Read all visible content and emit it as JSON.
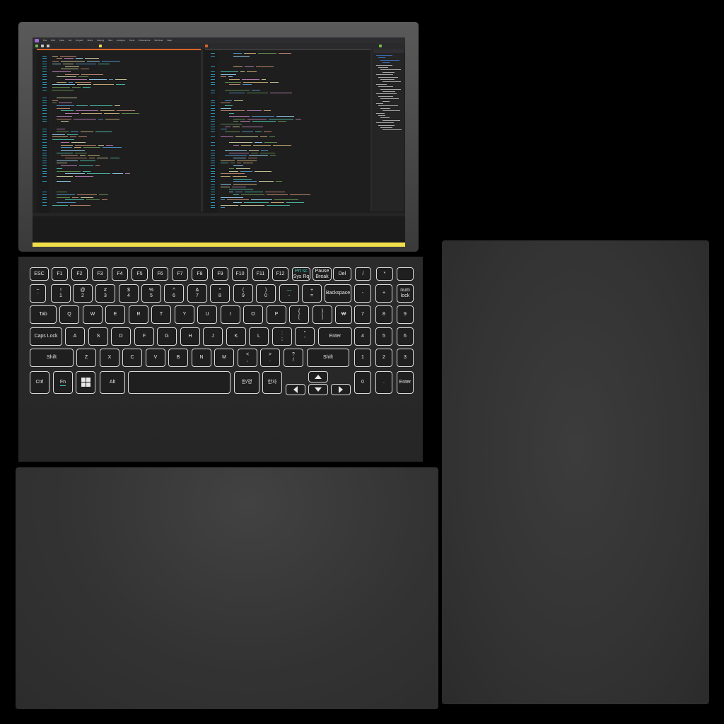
{
  "screen": {
    "menu_items": [
      "File",
      "Edit",
      "View",
      "Git",
      "Project",
      "Build",
      "Debug",
      "Test",
      "Analyze",
      "Tools",
      "Extensions",
      "Window",
      "Help"
    ],
    "colors": {
      "editor_bg": "#1e1e1e",
      "tab_accent": "#d9662b",
      "status_bar": "#f2e04a",
      "code_palette": [
        "#4ec9b0",
        "#dcdcaa",
        "#569cd6",
        "#ce9178",
        "#9cdcfe",
        "#c586c0",
        "#6a9955",
        "#d7ba7d"
      ]
    }
  },
  "keyboard": {
    "rows": [
      [
        {
          "name": "key-esc",
          "top": "ESC"
        },
        {
          "name": "key-f1",
          "top": "F1"
        },
        {
          "name": "key-f2",
          "top": "F2"
        },
        {
          "name": "key-f3",
          "top": "F3"
        },
        {
          "name": "key-f4",
          "top": "F4"
        },
        {
          "name": "key-f5",
          "top": "F5"
        },
        {
          "name": "key-f6",
          "top": "F6"
        },
        {
          "name": "key-f7",
          "top": "F7"
        },
        {
          "name": "key-f8",
          "top": "F8"
        },
        {
          "name": "key-f9",
          "top": "F9"
        },
        {
          "name": "key-f10",
          "top": "F10"
        },
        {
          "name": "key-f11",
          "top": "F11"
        },
        {
          "name": "key-f12",
          "top": "F12"
        },
        {
          "name": "key-prtsc",
          "top": "Prt sc",
          "bottom": "Sys Rq",
          "accent": true
        },
        {
          "name": "key-pause",
          "top": "Pause",
          "bottom": "Break"
        },
        {
          "name": "key-del",
          "top": "Del"
        },
        {
          "name": "key-numpad-divide",
          "top": "/"
        },
        {
          "name": "key-numpad-multiply",
          "top": "*"
        },
        {
          "name": "key-blank",
          "top": ""
        }
      ],
      [
        {
          "name": "key-tilde",
          "top": "~",
          "bottom": "`"
        },
        {
          "name": "key-1",
          "top": "!",
          "bottom": "1"
        },
        {
          "name": "key-2",
          "top": "@",
          "bottom": "2"
        },
        {
          "name": "key-3",
          "top": "#",
          "bottom": "3"
        },
        {
          "name": "key-4",
          "top": "$",
          "bottom": "4"
        },
        {
          "name": "key-5",
          "top": "%",
          "bottom": "5"
        },
        {
          "name": "key-6",
          "top": "^",
          "bottom": "6"
        },
        {
          "name": "key-7",
          "top": "&",
          "bottom": "7"
        },
        {
          "name": "key-8",
          "top": "*",
          "bottom": "8"
        },
        {
          "name": "key-9",
          "top": "(",
          "bottom": "9"
        },
        {
          "name": "key-0",
          "top": ")",
          "bottom": "0"
        },
        {
          "name": "key-minus",
          "top": "—",
          "bottom": "-",
          "accent": true
        },
        {
          "name": "key-equals",
          "top": "+",
          "bottom": "="
        },
        {
          "name": "key-backspace",
          "top": "Backspace"
        },
        {
          "name": "key-numpad-minus",
          "top": "-"
        },
        {
          "name": "key-numpad-plus",
          "top": "+"
        },
        {
          "name": "key-numlock",
          "top": "num",
          "bottom": "lock"
        }
      ],
      [
        {
          "name": "key-tab",
          "top": "Tab"
        },
        {
          "name": "key-q",
          "top": "Q"
        },
        {
          "name": "key-w",
          "top": "W"
        },
        {
          "name": "key-e",
          "top": "E"
        },
        {
          "name": "key-r",
          "top": "R"
        },
        {
          "name": "key-t",
          "top": "T"
        },
        {
          "name": "key-y",
          "top": "Y"
        },
        {
          "name": "key-u",
          "top": "U"
        },
        {
          "name": "key-i",
          "top": "I"
        },
        {
          "name": "key-o",
          "top": "O"
        },
        {
          "name": "key-p",
          "top": "P"
        },
        {
          "name": "key-left-bracket",
          "top": "{",
          "bottom": "["
        },
        {
          "name": "key-right-bracket",
          "top": "}",
          "bottom": "]"
        },
        {
          "name": "key-backslash",
          "top": "₩"
        },
        {
          "name": "key-numpad-7",
          "top": "7"
        },
        {
          "name": "key-numpad-8",
          "top": "8"
        },
        {
          "name": "key-numpad-9",
          "top": "9"
        }
      ],
      [
        {
          "name": "key-capslock",
          "top": "Caps Lock"
        },
        {
          "name": "key-a",
          "top": "A"
        },
        {
          "name": "key-s",
          "top": "S"
        },
        {
          "name": "key-d",
          "top": "D"
        },
        {
          "name": "key-f",
          "top": "F"
        },
        {
          "name": "key-g",
          "top": "G"
        },
        {
          "name": "key-h",
          "top": "H"
        },
        {
          "name": "key-j",
          "top": "J"
        },
        {
          "name": "key-k",
          "top": "K"
        },
        {
          "name": "key-l",
          "top": "L"
        },
        {
          "name": "key-semicolon",
          "top": ":",
          "bottom": ";"
        },
        {
          "name": "key-quote",
          "top": "\"",
          "bottom": "'"
        },
        {
          "name": "key-enter",
          "top": "Enter"
        },
        {
          "name": "key-numpad-4",
          "top": "4"
        },
        {
          "name": "key-numpad-5",
          "top": "5"
        },
        {
          "name": "key-numpad-6",
          "top": "6"
        }
      ],
      [
        {
          "name": "key-shift-left",
          "top": "Shift"
        },
        {
          "name": "key-z",
          "top": "Z"
        },
        {
          "name": "key-x",
          "top": "X"
        },
        {
          "name": "key-c",
          "top": "C"
        },
        {
          "name": "key-v",
          "top": "V"
        },
        {
          "name": "key-b",
          "top": "B"
        },
        {
          "name": "key-n",
          "top": "N"
        },
        {
          "name": "key-m",
          "top": "M"
        },
        {
          "name": "key-comma",
          "top": "<",
          "bottom": ","
        },
        {
          "name": "key-period",
          "top": ">",
          "bottom": "."
        },
        {
          "name": "key-slash",
          "top": "?",
          "bottom": "/"
        },
        {
          "name": "key-shift-right",
          "top": "Shift"
        },
        {
          "name": "key-numpad-1",
          "top": "1"
        },
        {
          "name": "key-numpad-2",
          "top": "2"
        },
        {
          "name": "key-numpad-3",
          "top": "3"
        }
      ],
      [
        {
          "name": "key-ctrl",
          "top": "Ctrl"
        },
        {
          "name": "key-fn",
          "top": "Fn",
          "fn": true
        },
        {
          "name": "key-windows",
          "icon": "windows-icon"
        },
        {
          "name": "key-alt",
          "top": "Alt"
        },
        {
          "name": "key-space",
          "top": ""
        },
        {
          "name": "key-hangul",
          "top": "한/영"
        },
        {
          "name": "key-hanja",
          "top": "한자"
        },
        {
          "name": "key-arrow-left",
          "icon": "arrow-left-icon"
        },
        {
          "name": "key-arrow-up",
          "icon": "arrow-up-icon"
        },
        {
          "name": "key-arrow-down",
          "icon": "arrow-down-icon"
        },
        {
          "name": "key-arrow-right",
          "icon": "arrow-right-icon"
        },
        {
          "name": "key-numpad-0",
          "top": "0"
        },
        {
          "name": "key-numpad-period",
          "top": "."
        },
        {
          "name": "key-numpad-enter",
          "top": "Enter"
        }
      ]
    ],
    "key_border_color": "#d9d9d9",
    "accent_color": "#3cc9b8"
  }
}
